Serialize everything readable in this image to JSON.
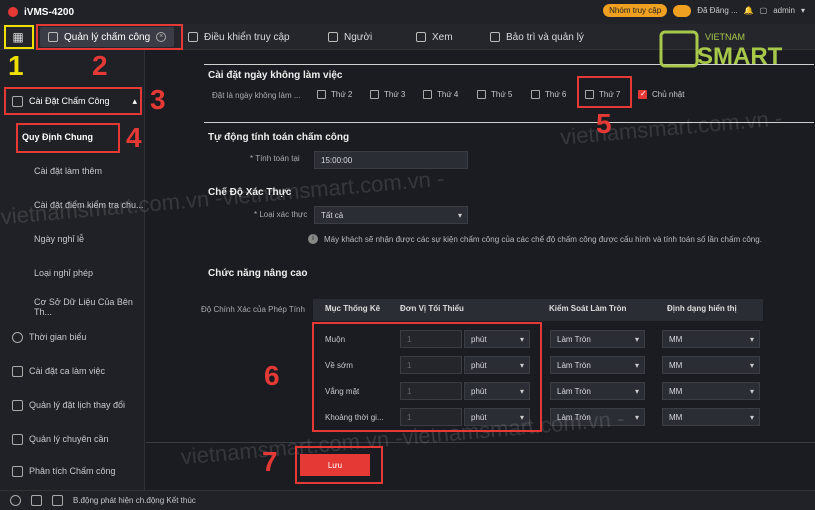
{
  "app": {
    "name": "iVMS-4200",
    "group_badge": "Nhóm truy cập",
    "login": "Đã Đăng ...",
    "user": "admin"
  },
  "tabs": [
    {
      "label": "Quản lý chấm công"
    },
    {
      "label": "Điều khiển truy cập"
    },
    {
      "label": "Người"
    },
    {
      "label": "Xem"
    },
    {
      "label": "Bảo trì và quản lý"
    }
  ],
  "sidebar": {
    "group": "Cài Đặt Chấm Công",
    "items": [
      "Quy Định Chung",
      "Cài đặt làm thêm",
      "Cài đặt điểm kiểm tra chu...",
      "Ngày nghỉ lễ",
      "Loại nghỉ phép",
      "Cơ Sở Dữ Liệu Của Bên Th..."
    ],
    "main_items": [
      "Thời gian biểu",
      "Cài đặt ca làm việc",
      "Quản lý đặt lịch thay đổi",
      "Quản lý chuyên cần",
      "Phân tích Chấm công"
    ]
  },
  "nonwork": {
    "title": "Cài đặt ngày không làm việc",
    "label": "Đặt là ngày không làm ...",
    "days": [
      {
        "label": "Thứ 2",
        "checked": false
      },
      {
        "label": "Thứ 3",
        "checked": false
      },
      {
        "label": "Thứ 4",
        "checked": false
      },
      {
        "label": "Thứ 5",
        "checked": false
      },
      {
        "label": "Thứ 6",
        "checked": false
      },
      {
        "label": "Thứ 7",
        "checked": false
      },
      {
        "label": "Chủ nhật",
        "checked": true
      }
    ]
  },
  "auto_calc": {
    "title": "Tự động tính toán chấm công",
    "label": "* Tính toán tại",
    "value": "15:00:00"
  },
  "auth_mode": {
    "title": "Chế Độ Xác Thực",
    "label": "* Loại xác thực",
    "value": "Tất cả",
    "info": "Máy khách sẽ nhận được các sự kiện chấm công của các chế độ chấm công được cấu hình và tính toán số lần chấm công."
  },
  "advanced": {
    "title": "Chức năng nâng cao",
    "precision_label": "Độ Chính Xác của Phép Tính",
    "headers": [
      "Mục Thống Kê",
      "Đơn Vị Tối Thiểu",
      "Kiểm Soát Làm Tròn",
      "Định dạng hiển thị"
    ],
    "rows": [
      {
        "item": "Muộn",
        "min": "1",
        "unit": "phút",
        "round": "Làm Tròn",
        "fmt": "MM"
      },
      {
        "item": "Về sớm",
        "min": "1",
        "unit": "phút",
        "round": "Làm Tròn",
        "fmt": "MM"
      },
      {
        "item": "Vắng mặt",
        "min": "1",
        "unit": "phút",
        "round": "Làm Tròn",
        "fmt": "MM"
      },
      {
        "item": "Khoảng thời gi...",
        "min": "1",
        "unit": "phút",
        "round": "Làm Tròn",
        "fmt": "MM"
      }
    ]
  },
  "save_label": "Lưu",
  "status": "B.động phát hiện ch.động Kết thúc",
  "annotations": [
    "1",
    "2",
    "3",
    "4",
    "5",
    "6",
    "7"
  ],
  "watermark": "vietnamsmart.com.vn -",
  "brand": {
    "small": "VIETNAM",
    "big": "SMART"
  },
  "colors": {
    "accent": "#e53935",
    "annotation_yellow": "#f0e000",
    "badge": "#f0a020"
  }
}
